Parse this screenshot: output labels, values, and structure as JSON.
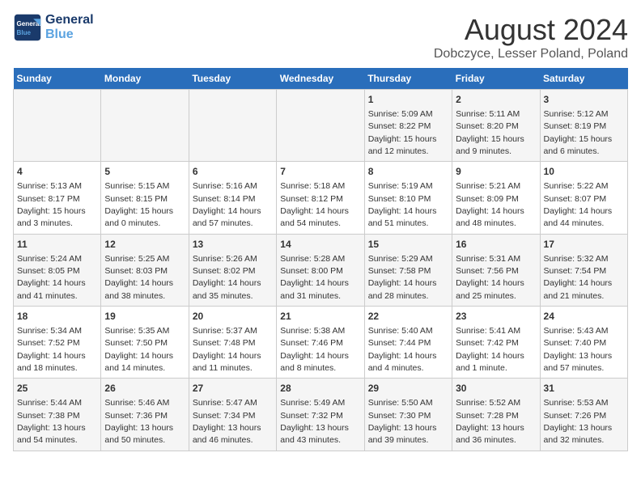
{
  "logo": {
    "line1": "General",
    "line2": "Blue"
  },
  "title": "August 2024",
  "subtitle": "Dobczyce, Lesser Poland, Poland",
  "days_of_week": [
    "Sunday",
    "Monday",
    "Tuesday",
    "Wednesday",
    "Thursday",
    "Friday",
    "Saturday"
  ],
  "weeks": [
    [
      {
        "day": "",
        "info": ""
      },
      {
        "day": "",
        "info": ""
      },
      {
        "day": "",
        "info": ""
      },
      {
        "day": "",
        "info": ""
      },
      {
        "day": "1",
        "info": "Sunrise: 5:09 AM\nSunset: 8:22 PM\nDaylight: 15 hours\nand 12 minutes."
      },
      {
        "day": "2",
        "info": "Sunrise: 5:11 AM\nSunset: 8:20 PM\nDaylight: 15 hours\nand 9 minutes."
      },
      {
        "day": "3",
        "info": "Sunrise: 5:12 AM\nSunset: 8:19 PM\nDaylight: 15 hours\nand 6 minutes."
      }
    ],
    [
      {
        "day": "4",
        "info": "Sunrise: 5:13 AM\nSunset: 8:17 PM\nDaylight: 15 hours\nand 3 minutes."
      },
      {
        "day": "5",
        "info": "Sunrise: 5:15 AM\nSunset: 8:15 PM\nDaylight: 15 hours\nand 0 minutes."
      },
      {
        "day": "6",
        "info": "Sunrise: 5:16 AM\nSunset: 8:14 PM\nDaylight: 14 hours\nand 57 minutes."
      },
      {
        "day": "7",
        "info": "Sunrise: 5:18 AM\nSunset: 8:12 PM\nDaylight: 14 hours\nand 54 minutes."
      },
      {
        "day": "8",
        "info": "Sunrise: 5:19 AM\nSunset: 8:10 PM\nDaylight: 14 hours\nand 51 minutes."
      },
      {
        "day": "9",
        "info": "Sunrise: 5:21 AM\nSunset: 8:09 PM\nDaylight: 14 hours\nand 48 minutes."
      },
      {
        "day": "10",
        "info": "Sunrise: 5:22 AM\nSunset: 8:07 PM\nDaylight: 14 hours\nand 44 minutes."
      }
    ],
    [
      {
        "day": "11",
        "info": "Sunrise: 5:24 AM\nSunset: 8:05 PM\nDaylight: 14 hours\nand 41 minutes."
      },
      {
        "day": "12",
        "info": "Sunrise: 5:25 AM\nSunset: 8:03 PM\nDaylight: 14 hours\nand 38 minutes."
      },
      {
        "day": "13",
        "info": "Sunrise: 5:26 AM\nSunset: 8:02 PM\nDaylight: 14 hours\nand 35 minutes."
      },
      {
        "day": "14",
        "info": "Sunrise: 5:28 AM\nSunset: 8:00 PM\nDaylight: 14 hours\nand 31 minutes."
      },
      {
        "day": "15",
        "info": "Sunrise: 5:29 AM\nSunset: 7:58 PM\nDaylight: 14 hours\nand 28 minutes."
      },
      {
        "day": "16",
        "info": "Sunrise: 5:31 AM\nSunset: 7:56 PM\nDaylight: 14 hours\nand 25 minutes."
      },
      {
        "day": "17",
        "info": "Sunrise: 5:32 AM\nSunset: 7:54 PM\nDaylight: 14 hours\nand 21 minutes."
      }
    ],
    [
      {
        "day": "18",
        "info": "Sunrise: 5:34 AM\nSunset: 7:52 PM\nDaylight: 14 hours\nand 18 minutes."
      },
      {
        "day": "19",
        "info": "Sunrise: 5:35 AM\nSunset: 7:50 PM\nDaylight: 14 hours\nand 14 minutes."
      },
      {
        "day": "20",
        "info": "Sunrise: 5:37 AM\nSunset: 7:48 PM\nDaylight: 14 hours\nand 11 minutes."
      },
      {
        "day": "21",
        "info": "Sunrise: 5:38 AM\nSunset: 7:46 PM\nDaylight: 14 hours\nand 8 minutes."
      },
      {
        "day": "22",
        "info": "Sunrise: 5:40 AM\nSunset: 7:44 PM\nDaylight: 14 hours\nand 4 minutes."
      },
      {
        "day": "23",
        "info": "Sunrise: 5:41 AM\nSunset: 7:42 PM\nDaylight: 14 hours\nand 1 minute."
      },
      {
        "day": "24",
        "info": "Sunrise: 5:43 AM\nSunset: 7:40 PM\nDaylight: 13 hours\nand 57 minutes."
      }
    ],
    [
      {
        "day": "25",
        "info": "Sunrise: 5:44 AM\nSunset: 7:38 PM\nDaylight: 13 hours\nand 54 minutes."
      },
      {
        "day": "26",
        "info": "Sunrise: 5:46 AM\nSunset: 7:36 PM\nDaylight: 13 hours\nand 50 minutes."
      },
      {
        "day": "27",
        "info": "Sunrise: 5:47 AM\nSunset: 7:34 PM\nDaylight: 13 hours\nand 46 minutes."
      },
      {
        "day": "28",
        "info": "Sunrise: 5:49 AM\nSunset: 7:32 PM\nDaylight: 13 hours\nand 43 minutes."
      },
      {
        "day": "29",
        "info": "Sunrise: 5:50 AM\nSunset: 7:30 PM\nDaylight: 13 hours\nand 39 minutes."
      },
      {
        "day": "30",
        "info": "Sunrise: 5:52 AM\nSunset: 7:28 PM\nDaylight: 13 hours\nand 36 minutes."
      },
      {
        "day": "31",
        "info": "Sunrise: 5:53 AM\nSunset: 7:26 PM\nDaylight: 13 hours\nand 32 minutes."
      }
    ]
  ]
}
